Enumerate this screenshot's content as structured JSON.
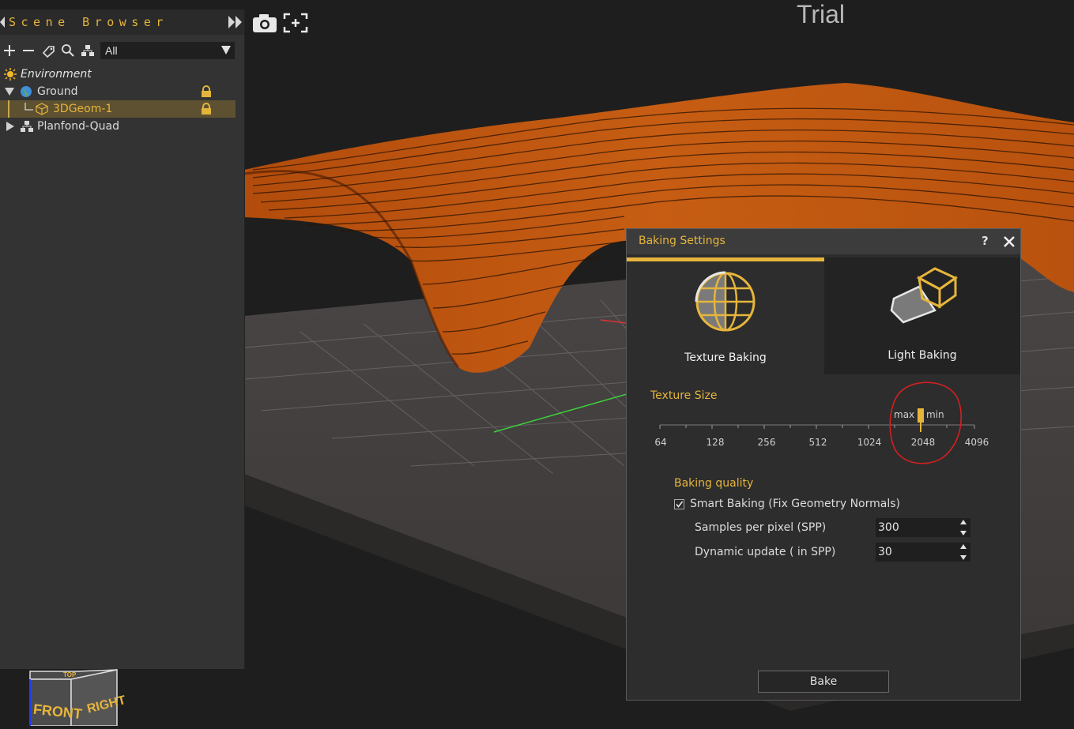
{
  "viewport": {
    "watermark": "Trial",
    "camera_icon": "camera-icon",
    "focus_icon": "focus-frame-icon",
    "view_cube": {
      "front": "FRONT",
      "right": "RIGHT",
      "top": "TOP"
    }
  },
  "scene_browser": {
    "title": "Scene Browser",
    "filter_value": "All",
    "toolbar_icons": [
      "add-icon",
      "remove-icon",
      "tag-icon",
      "search-icon",
      "hierarchy-icon"
    ],
    "items": [
      {
        "label": "Environment",
        "icon": "sun-icon"
      },
      {
        "label": "Ground",
        "icon": "globe-icon",
        "locked": true,
        "expanded": true
      },
      {
        "label": "3DGeom-1",
        "icon": "cube-icon",
        "locked": true,
        "selected": true
      },
      {
        "label": "Planfond-Quad",
        "icon": "hierarchy-icon",
        "expanded": false
      }
    ]
  },
  "baking_dialog": {
    "title": "Baking Settings",
    "help": "?",
    "tabs": [
      {
        "label": "Texture Baking",
        "active": true
      },
      {
        "label": "Light Baking",
        "active": false
      }
    ],
    "texture_size": {
      "label": "Texture Size",
      "ticks": [
        "64",
        "128",
        "256",
        "512",
        "1024",
        "2048",
        "4096"
      ],
      "max_label": "max",
      "min_label": "min",
      "selected": "2048"
    },
    "quality": {
      "label": "Baking quality",
      "smart_baking_label": "Smart Baking (Fix Geometry Normals)",
      "smart_baking_checked": true,
      "spp_label": "Samples per pixel (SPP)",
      "spp_value": "300",
      "dynamic_label": "Dynamic update ( in SPP)",
      "dynamic_value": "30"
    },
    "bake_label": "Bake"
  },
  "colors": {
    "accent": "#e6b53c",
    "geometry": "#c2560f",
    "annotation": "#d42020"
  }
}
